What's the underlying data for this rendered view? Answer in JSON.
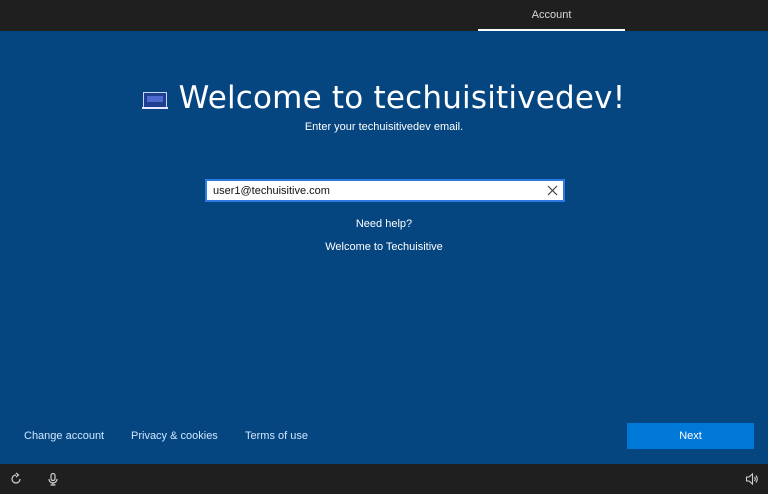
{
  "topbar": {
    "tab_label": "Account"
  },
  "hero": {
    "title": "Welcome to techuisitivedev!",
    "subtitle": "Enter your techuisitivedev email."
  },
  "email": {
    "value": "user1@techuisitive.com",
    "clear_icon": "close-icon"
  },
  "links": {
    "need_help": "Need help?",
    "welcome_text": "Welcome to Techuisitive"
  },
  "footer": {
    "change_account": "Change account",
    "privacy": "Privacy & cookies",
    "terms": "Terms of use",
    "next_label": "Next"
  },
  "taskbar": {
    "icons": [
      "ease-of-access-icon",
      "microphone-icon",
      "volume-icon"
    ]
  },
  "colors": {
    "background": "#064680",
    "bars": "#1f1f1f",
    "accent": "#0078d7"
  }
}
